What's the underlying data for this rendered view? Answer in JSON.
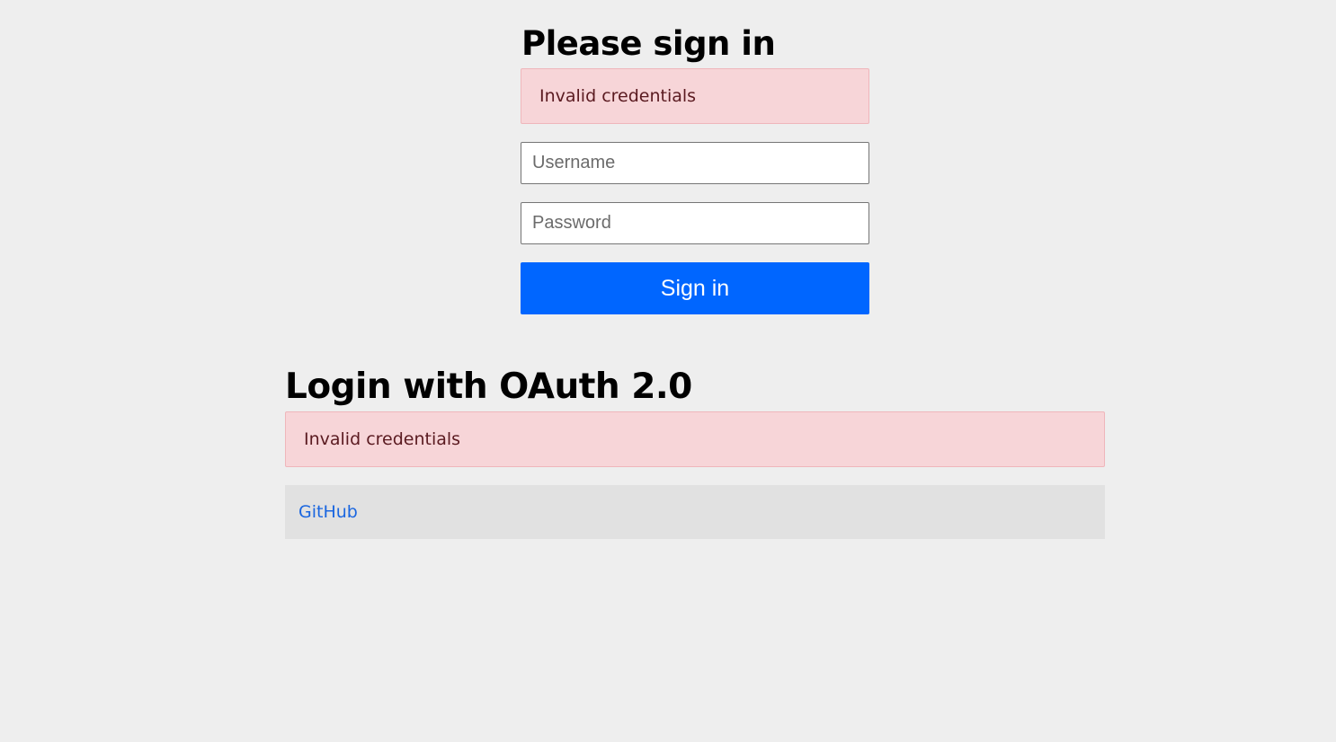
{
  "signin": {
    "heading": "Please sign in",
    "error": "Invalid credentials",
    "username_placeholder": "Username",
    "password_placeholder": "Password",
    "submit_label": "Sign in"
  },
  "oauth": {
    "heading": "Login with OAuth 2.0",
    "error": "Invalid credentials",
    "providers": [
      {
        "label": "GitHub"
      }
    ]
  },
  "colors": {
    "background": "#eeeeee",
    "alert_background": "#f7d5d8",
    "alert_text": "#5a1a20",
    "primary_button": "#0066ff",
    "link": "#1a66e0",
    "provider_row": "#e1e1e1"
  }
}
